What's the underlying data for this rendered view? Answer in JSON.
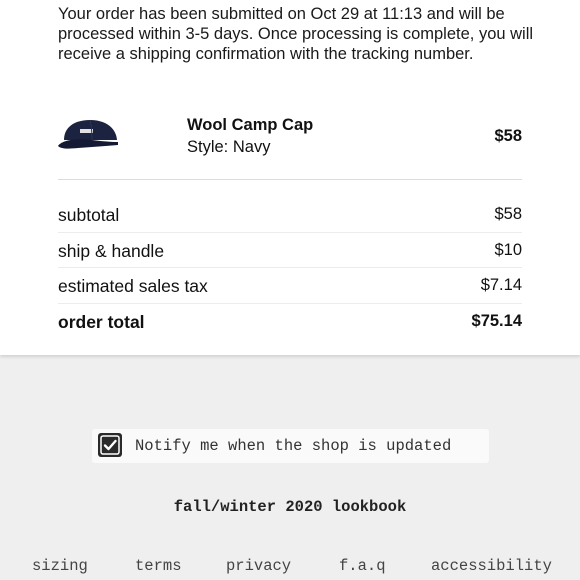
{
  "confirmation": {
    "message": "Your order has been submitted on Oct 29 at 11:13 and will be processed within 3-5 days. Once processing is complete, you will receive a shipping confirmation with the tracking number."
  },
  "item": {
    "name": "Wool Camp Cap",
    "style": "Style: Navy",
    "price": "$58",
    "image_icon": "cap-icon"
  },
  "summary": {
    "subtotal_label": "subtotal",
    "subtotal_value": "$58",
    "shipping_label": "ship & handle",
    "shipping_value": "$10",
    "tax_label": "estimated sales tax",
    "tax_value": "$7.14",
    "total_label": "order total",
    "total_value": "$75.14"
  },
  "notify": {
    "checked": true,
    "label": "Notify me when the shop is updated"
  },
  "lookbook": {
    "label": "fall/winter 2020 lookbook"
  },
  "footer": {
    "sizing": "sizing",
    "terms": "terms",
    "privacy": "privacy",
    "faq": "f.a.q",
    "accessibility": "accessibility"
  },
  "colors": {
    "background": "#efefef",
    "card": "#ffffff",
    "cap_navy": "#1c2340",
    "checkbox": "#2a2a2a"
  }
}
